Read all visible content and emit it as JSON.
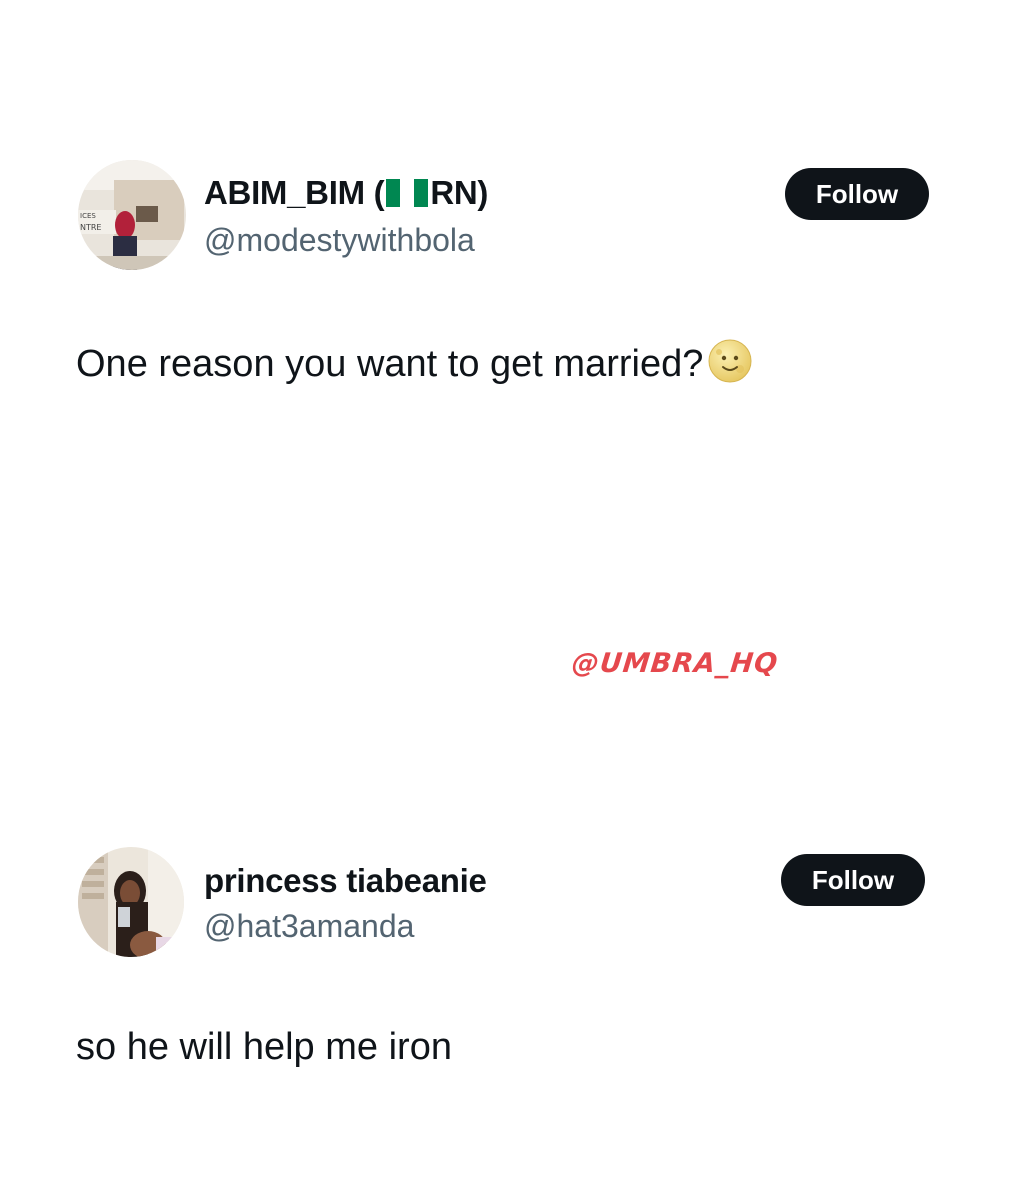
{
  "tweets": [
    {
      "display_name_prefix": "ABIM_BIM (",
      "display_name_suffix": "RN)",
      "flag_icon": "nigeria-flag-icon",
      "handle": "@modestywithbola",
      "follow_label": "Follow",
      "text": "One reason you want to get married?",
      "emoji_icon": "full-moon-face-icon"
    },
    {
      "display_name": "princess tiabeanie",
      "handle": "@hat3amanda",
      "follow_label": "Follow",
      "text": "so he will help me iron"
    }
  ],
  "watermark": "@UMBRA_HQ",
  "colors": {
    "text": "#0f1419",
    "handle": "#536471",
    "button_bg": "#0f1419",
    "button_text": "#ffffff",
    "watermark": "#e5484d",
    "flag_green": "#008751"
  }
}
